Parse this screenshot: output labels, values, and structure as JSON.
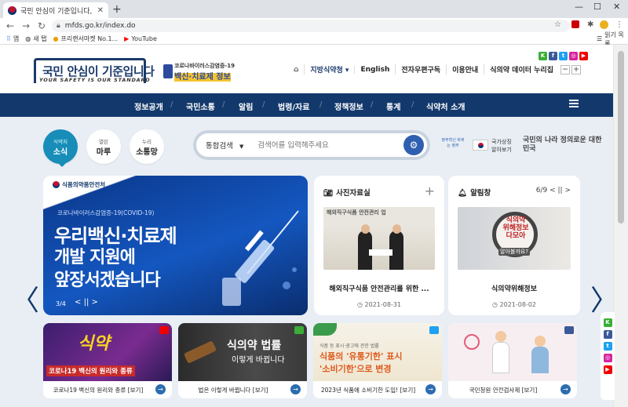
{
  "browser": {
    "tab_title": "국민 안심이 기준입니다, 식품의",
    "new_tab": "+",
    "url": "mfds.go.kr/index.do",
    "bookmarks": [
      "앱",
      "새 탭",
      "프리랜서마켓 No.1...",
      "YouTube"
    ],
    "reading_list": "읽기 목록"
  },
  "header": {
    "logo_main": "국민 안심이 기준입니다",
    "logo_sub": "YOUR SAFETY IS OUR STANDARD",
    "covid_line1": "코로나바이러스감염증-19",
    "covid_line2": "백신·치료제 정보",
    "util": [
      "지방식약청",
      "English",
      "전자우편구독",
      "이용안내",
      "식의약 데이터 누리집"
    ],
    "zoom_minus": "−",
    "zoom_plus": "+"
  },
  "nav": [
    "정보공개",
    "국민소통",
    "알림",
    "법령/자료",
    "정책정보",
    "통계",
    "식약처 소개"
  ],
  "quick": [
    {
      "small": "식약처",
      "big": "소식"
    },
    {
      "small": "열린",
      "big": "마루"
    },
    {
      "small": "누리",
      "big": "소통망"
    }
  ],
  "search": {
    "category": "통합검색",
    "placeholder": "검색어를 입력해주세요"
  },
  "right_logos": {
    "gov": "정부혁신 바뀌는 정부",
    "flag_label1": "국가상징",
    "flag_label2": "알아보기",
    "nation": "국민의 나라 정의로운 대한민국"
  },
  "banner": {
    "org": "식품의약품안전처",
    "sub": "코로나바이러스감염증-19(COVID-19)",
    "line1": "우리백신·치료제",
    "line2": "개발 지원에",
    "line3": "앞장서겠습니다",
    "pager": "3/4"
  },
  "cards": [
    {
      "title": "사진자료실",
      "caption": "해외직구식품 안전관리를 위한 ...",
      "date": "2021-08-31",
      "img_text": "해외직구식품 안전관리 업"
    },
    {
      "title": "알림창",
      "pager": "6/9",
      "caption": "식의약위해정보",
      "date": "2021-08-02",
      "img_text1": "식의약",
      "img_text2": "위해정보",
      "img_text3": "다모아",
      "img_text4": "알아볼까요?"
    }
  ],
  "thumbs": [
    {
      "label": "코로나19 백신의 원리와 종류 [보기]",
      "overlay": "코로나19 백신의 원리와 종류",
      "accent": "식약"
    },
    {
      "label": "법은 이렇게 바뀝니다 [보기]",
      "overlay1": "식의약 법률",
      "overlay2": "이렇게 바뀝니다"
    },
    {
      "label": "2023년 식품에 소비기한 도입! [보기]",
      "overlay1": "식품의 '유통기한' 표시",
      "overlay2": "'소비기한'으로 변경",
      "small": "식품 등 표시·광고에 관한 법률"
    },
    {
      "label": "국민청원 안전검사제 [보기]"
    }
  ],
  "colors": {
    "navy": "#13396c",
    "teal": "#178db8",
    "bg": "#e9eef5"
  }
}
